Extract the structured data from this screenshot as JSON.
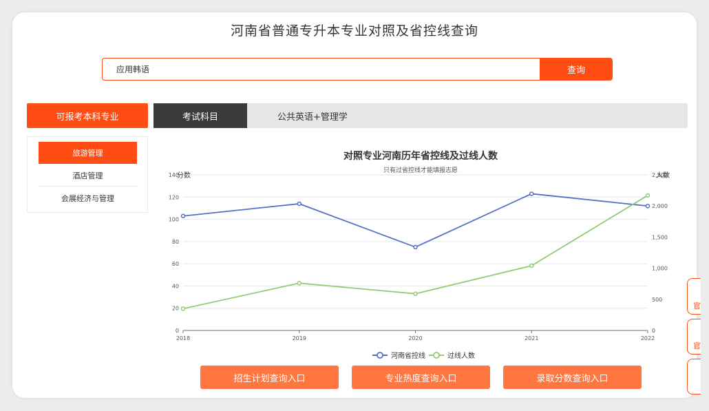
{
  "header": {
    "title": "河南省普通专升本专业对照及省控线查询"
  },
  "search": {
    "value": "应用韩语",
    "button_label": "查询"
  },
  "majors": {
    "header": "可报考本科专业",
    "items": [
      {
        "label": "旅游管理",
        "active": true
      },
      {
        "label": "酒店管理",
        "active": false
      },
      {
        "label": "会展经济与管理",
        "active": false
      }
    ]
  },
  "tabs": {
    "exam_label": "考试科目",
    "subjects": "公共英语+管理学"
  },
  "actions": [
    {
      "label": "招生计划查询入口"
    },
    {
      "label": "专业热度查询入口"
    },
    {
      "label": "录取分数查询入口"
    }
  ],
  "side_float": {
    "glyphs": [
      "官",
      "官"
    ]
  },
  "chart_data": {
    "type": "line",
    "title": "对照专业河南历年省控线及过线人数",
    "subtitle": "只有过省控线才能填报志愿",
    "ylabel_left": "分数",
    "ylabel_right": "人数",
    "x": [
      "2018",
      "2019",
      "2020",
      "2021",
      "2022"
    ],
    "ylim_left": [
      0,
      140
    ],
    "yticks_left": [
      "0",
      "20",
      "40",
      "60",
      "80",
      "100",
      "120",
      "140"
    ],
    "ylim_right": [
      0,
      2500
    ],
    "yticks_right": [
      "0",
      "500",
      "1,000",
      "1,500",
      "2,000",
      "2,500"
    ],
    "grid": true,
    "legend": "bottom",
    "series": [
      {
        "name": "河南省控线",
        "axis": "left",
        "color": "#5470c6",
        "values": [
          103,
          114,
          75,
          123,
          112
        ]
      },
      {
        "name": "过线人数",
        "axis": "right",
        "color": "#91cc75",
        "values": [
          350,
          760,
          590,
          1040,
          2170
        ]
      }
    ]
  }
}
